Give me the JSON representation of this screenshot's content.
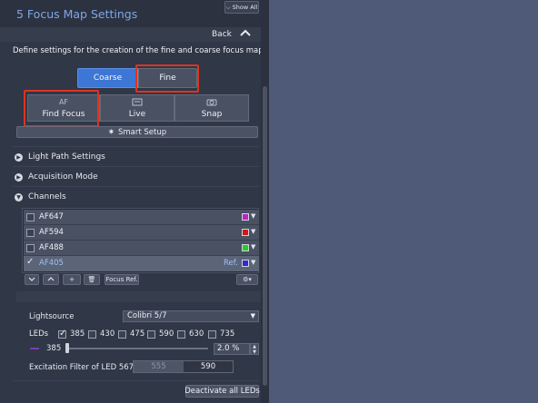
{
  "panel": {
    "title": "5  Focus Map Settings",
    "show_all": "Show All",
    "back": "Back",
    "description": "Define settings for the creation of the fine and coarse focus map."
  },
  "mode_toggle": {
    "coarse": "Coarse",
    "fine": "Fine",
    "selected": "Coarse"
  },
  "actions": [
    {
      "label": "Find Focus",
      "icon_text": "AF",
      "icon": "af-icon"
    },
    {
      "label": "Live",
      "icon": "live-icon"
    },
    {
      "label": "Snap",
      "icon": "camera-icon"
    }
  ],
  "smart_setup": "Smart Setup",
  "sections": {
    "light_path": "Light Path Settings",
    "acquisition": "Acquisition Mode",
    "channels": "Channels"
  },
  "channels": [
    {
      "name": "AF647",
      "checked": false,
      "color": "#c020c8"
    },
    {
      "name": "AF594",
      "checked": false,
      "color": "#d01818"
    },
    {
      "name": "AF488",
      "checked": false,
      "color": "#20d020"
    },
    {
      "name": "AF405",
      "checked": true,
      "color": "#2a2ad8",
      "ref": "Ref."
    }
  ],
  "channel_toolbar": {
    "focus_ref": "Focus Ref."
  },
  "light": {
    "lightsource_label": "Lightsource",
    "lightsource_value": "Colibri 5/7",
    "leds_label": "LEDs",
    "leds": [
      {
        "value": "385",
        "checked": true
      },
      {
        "value": "430",
        "checked": false
      },
      {
        "value": "475",
        "checked": false
      },
      {
        "value": "590",
        "checked": false
      },
      {
        "value": "630",
        "checked": false
      },
      {
        "value": "735",
        "checked": false
      }
    ],
    "slider_led": "385",
    "intensity": "2.0 %",
    "intensity_fraction": 0.02,
    "filter_label": "Excitation Filter of LED 567",
    "filter_options": [
      "555",
      "590"
    ],
    "filter_selected": "590"
  },
  "deactivate": "Deactivate all LEDs"
}
